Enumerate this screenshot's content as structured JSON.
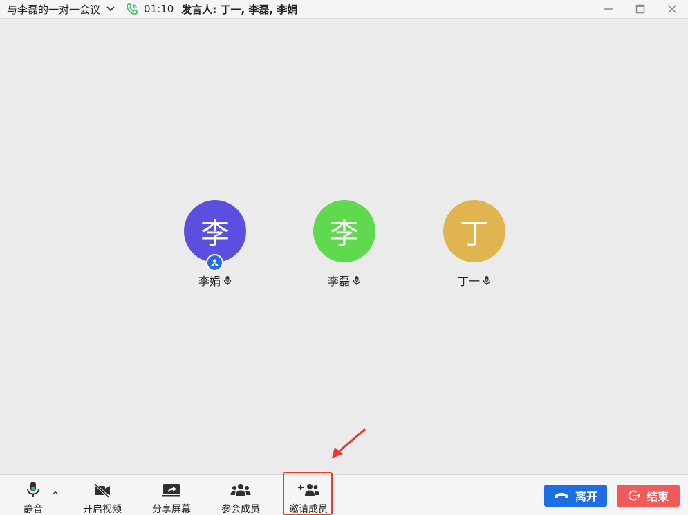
{
  "titlebar": {
    "meeting_title": "与李磊的一对一会议",
    "timer": "01:10",
    "speakers_label": "发言人:",
    "speakers_names": "丁一, 李磊, 李娟"
  },
  "participants": [
    {
      "avatar_char": "李",
      "name": "李娟",
      "color": "#5b4fe0",
      "is_host": true
    },
    {
      "avatar_char": "李",
      "name": "李磊",
      "color": "#5fd94e",
      "is_host": false
    },
    {
      "avatar_char": "丁",
      "name": "丁一",
      "color": "#e0b44f",
      "is_host": false
    }
  ],
  "toolbar": {
    "mute_label": "静音",
    "video_label": "开启视频",
    "share_label": "分享屏幕",
    "members_label": "参会成员",
    "invite_label": "邀请成员",
    "leave_label": "离开",
    "end_label": "结束"
  },
  "icons": {
    "phone": "phone-call-icon",
    "dropdown": "chevron-down-icon",
    "minimize": "minimize-icon",
    "maximize": "maximize-icon",
    "close": "close-icon",
    "mic": "microphone-icon",
    "video_off": "video-off-icon",
    "share": "share-screen-icon",
    "members": "members-icon",
    "invite": "add-member-icon",
    "leave": "hang-up-icon",
    "end": "exit-icon"
  },
  "colors": {
    "accent_blue": "#1d6de5",
    "end_red": "#f05a5a",
    "highlight_red": "#e53b2c",
    "phone_green": "#3bbf6a"
  }
}
